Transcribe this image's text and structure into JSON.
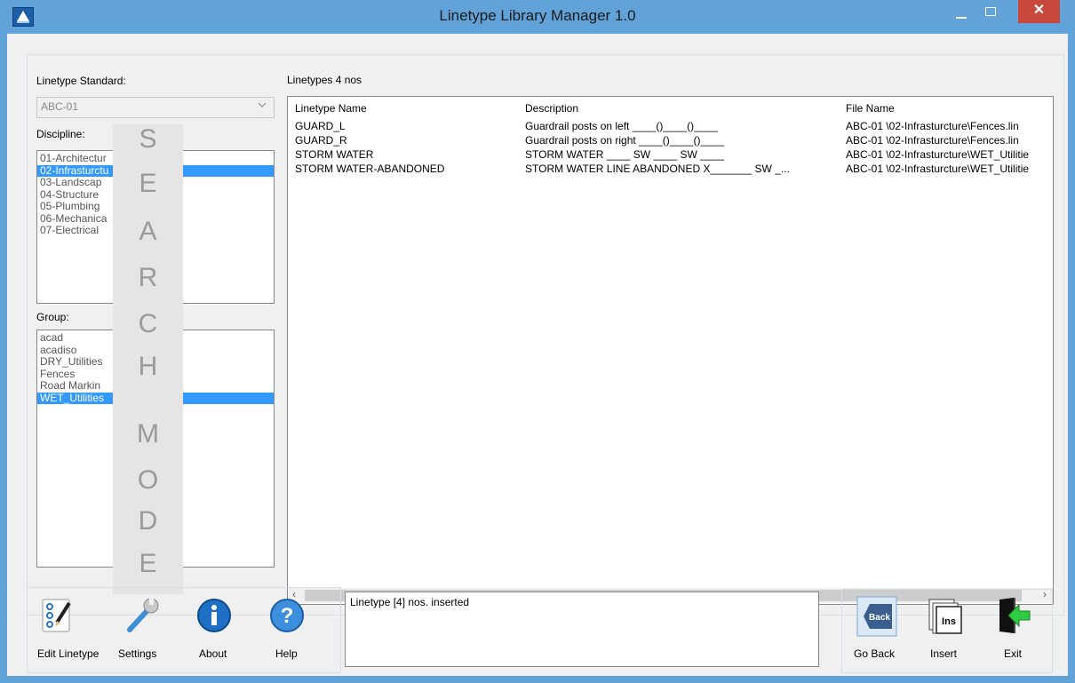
{
  "window": {
    "title": "Linetype Library Manager 1.0",
    "close_glyph": "✕"
  },
  "left": {
    "standard_label": "Linetype Standard:",
    "standard_value": "ABC-01",
    "discipline_label": "Discipline:",
    "disciplines": [
      "01-Architectur",
      "02-Infrasturctu",
      "03-Landscap",
      "04-Structure",
      "05-Plumbing",
      "06-Mechanica",
      "07-Electrical"
    ],
    "discipline_selected": 1,
    "group_label": "Group:",
    "groups": [
      "acad",
      "acadiso",
      "DRY_Utilities",
      "Fences",
      "Road Markin",
      "WET_Utilities"
    ],
    "group_selected": 5
  },
  "search_mode": [
    "S",
    "E",
    "A",
    "R",
    "C",
    "H",
    "M",
    "O",
    "D",
    "E"
  ],
  "main": {
    "linetypes_label": "Linetypes 4 nos",
    "columns": [
      "Linetype Name",
      "Description",
      "File Name"
    ],
    "rows": [
      [
        "GUARD_L",
        "Guardrail posts on left ____()____()____",
        "ABC-01 \\02-Infrasturcture\\Fences.lin"
      ],
      [
        "GUARD_R",
        "Guardrail posts on right ____()____()____",
        "ABC-01 \\02-Infrasturcture\\Fences.lin"
      ],
      [
        "STORM WATER",
        "STORM WATER ____ SW ____ SW ____",
        "ABC-01 \\02-Infrasturcture\\WET_Utilitie"
      ],
      [
        "STORM WATER-ABANDONED",
        "STORM WATER LINE ABANDONED  X_______ SW _...",
        "ABC-01 \\02-Infrasturcture\\WET_Utilitie"
      ]
    ],
    "scroll_left": "‹",
    "scroll_right": "›"
  },
  "toolbar": {
    "edit_linetype": "Edit Linetype",
    "settings": "Settings",
    "about": "About",
    "help": "Help"
  },
  "status": {
    "message": "Linetype [4] nos. inserted"
  },
  "actions": {
    "go_back": "Go Back",
    "back_icon_text": "Back",
    "insert": "Insert",
    "insert_icon_text": "Ins",
    "exit": "Exit"
  },
  "colors": {
    "titlebar": "#61a3d8",
    "selection": "#3399ff",
    "close": "#c9483c"
  }
}
